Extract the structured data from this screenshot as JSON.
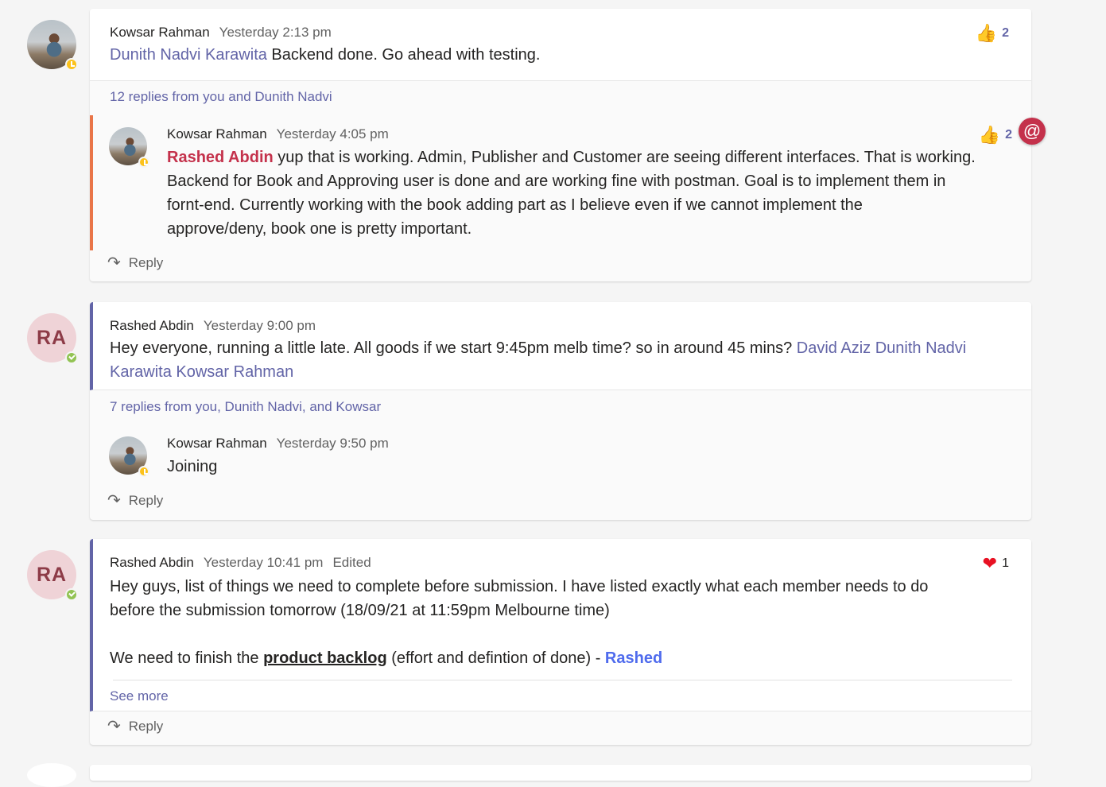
{
  "threads": [
    {
      "root": {
        "author": "Kowsar Rahman",
        "time": "Yesterday 2:13 pm",
        "mention": "Dunith Nadvi Karawita",
        "text": " Backend done. Go ahead with testing.",
        "reaction_count": "2"
      },
      "reply_summary": "12 replies from you and Dunith Nadvi",
      "reply": {
        "author": "Kowsar Rahman",
        "time": "Yesterday 4:05 pm",
        "mention": "Rashed Abdin",
        "line1": " yup that is working. Admin, Publisher and Customer are seeing different interfaces. That is working.",
        "line2": "Backend for Book and Approving user is done and are working fine with postman. Goal is to implement them in",
        "line3": "fornt-end. Currently working with the book adding part as I believe even if we cannot implement the",
        "line4": "approve/deny, book one is pretty important.",
        "reaction_count": "2"
      },
      "reply_label": "Reply",
      "mention_badge": "@"
    },
    {
      "avatar_initials": "RA",
      "root": {
        "author": "Rashed Abdin",
        "time": "Yesterday 9:00 pm",
        "text": "Hey everyone, running a little late. All goods if we start 9:45pm melb time? so in around 45 mins? ",
        "mention_a": "David Aziz",
        "mention_b1": "Dunith Nadvi",
        "mention_b2": "Karawita",
        "mention_c": "Kowsar Rahman"
      },
      "reply_summary": "7 replies from you, Dunith Nadvi, and Kowsar",
      "reply": {
        "author": "Kowsar Rahman",
        "time": "Yesterday 9:50 pm",
        "text": "Joining"
      },
      "reply_label": "Reply"
    },
    {
      "avatar_initials": "RA",
      "root": {
        "author": "Rashed Abdin",
        "time": "Yesterday 10:41 pm",
        "edited": "Edited",
        "line1": "Hey guys, list of things we need to complete before submission. I have listed exactly what each member needs to do",
        "line2": "before the submission tomorrow (18/09/21 at 11:59pm Melbourne time)",
        "line3_pre": "We need to finish the ",
        "line3_bold": "product backlog",
        "line3_post": " (effort and defintion of done) - ",
        "line3_name": "Rashed",
        "reaction_count": "1"
      },
      "see_more": "See more",
      "reply_label": "Reply"
    }
  ],
  "icons": {
    "like": "thumbs-up-icon",
    "heart": "heart-icon",
    "reply": "reply-arrow-icon",
    "mention": "at-mention-icon"
  },
  "colors": {
    "accent": "#6264a7",
    "mention_me": "#c4314b",
    "away": "#fcc21b",
    "online": "#92c353",
    "orange_bar": "#e97548"
  }
}
